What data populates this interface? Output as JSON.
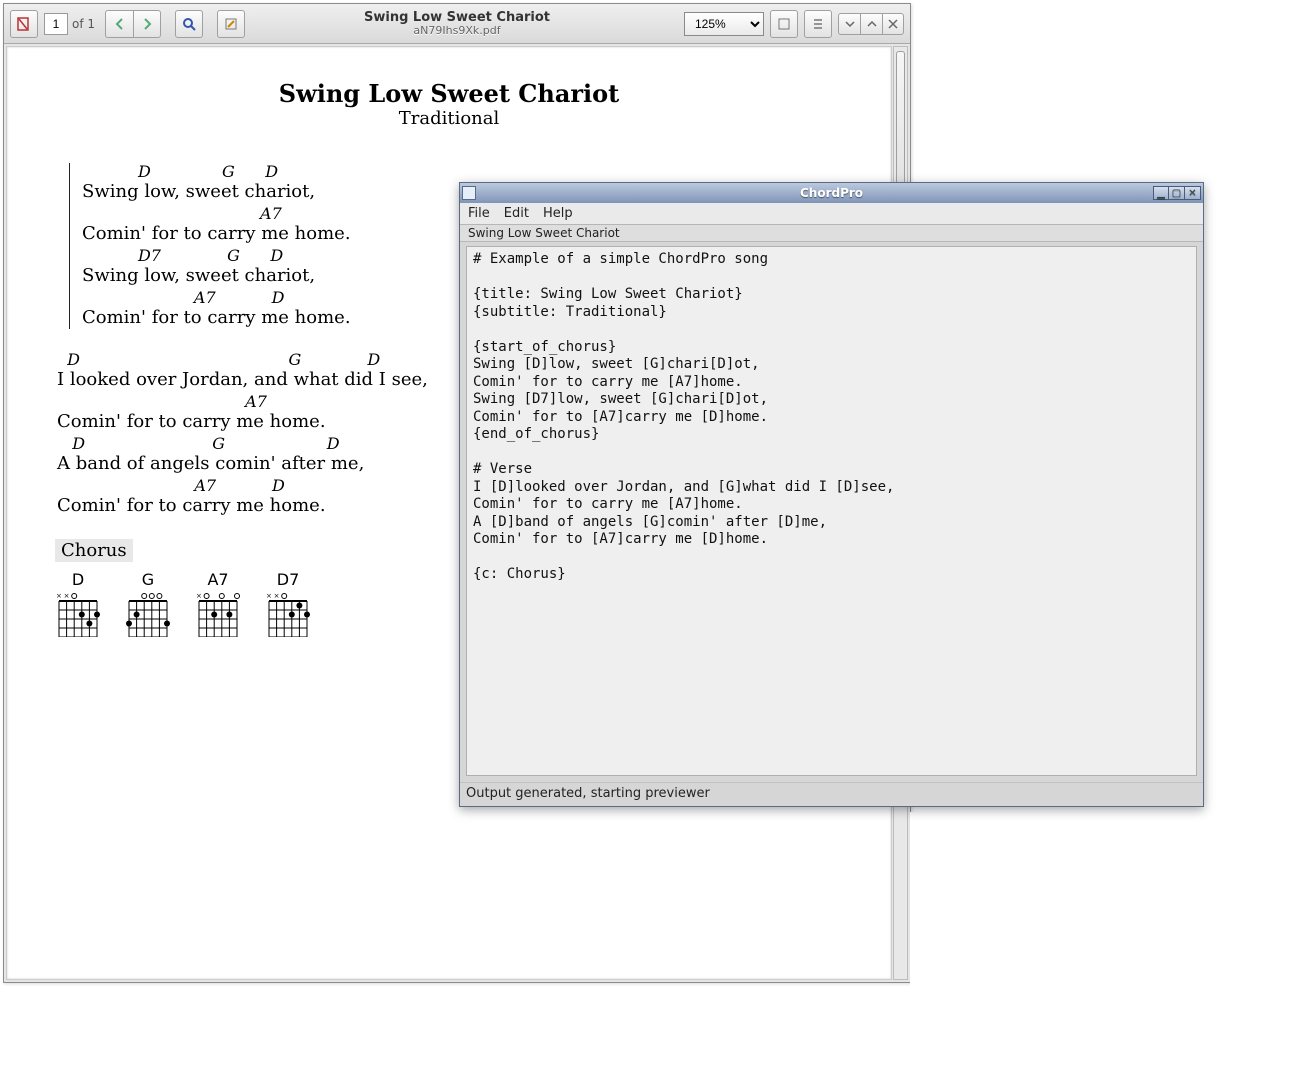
{
  "pdf_viewer": {
    "doc_title": "Swing Low Sweet Chariot",
    "doc_filename": "aN79Ihs9Xk.pdf",
    "page_current": "1",
    "page_of": "of 1",
    "zoom": "125%"
  },
  "song": {
    "title": "Swing Low Sweet Chariot",
    "subtitle": "Traditional",
    "chorus": [
      {
        "chords": "           D              G      D",
        "lyric": "Swing low, sweet chariot,"
      },
      {
        "chords": "                                   A7",
        "lyric": "Comin' for to carry me home."
      },
      {
        "chords": "           D7             G      D",
        "lyric": "Swing low, sweet chariot,"
      },
      {
        "chords": "                      A7           D",
        "lyric": "Comin' for to carry me home."
      }
    ],
    "verse": [
      {
        "chords": "  D                                         G             D",
        "lyric": "I looked over Jordan, and what did I see,"
      },
      {
        "chords": "                                     A7",
        "lyric": "Comin' for to carry me home."
      },
      {
        "chords": "   D                         G                    D",
        "lyric": "A band of angels comin' after me,"
      },
      {
        "chords": "                           A7           D",
        "lyric": "Comin' for to carry me home."
      }
    ],
    "chorus_tag": "Chorus",
    "diagrams": [
      "D",
      "G",
      "A7",
      "D7"
    ]
  },
  "editor": {
    "app_title": "ChordPro",
    "menu": {
      "file": "File",
      "edit": "Edit",
      "help": "Help"
    },
    "tab": "Swing Low Sweet Chariot",
    "text": "# Example of a simple ChordPro song\n\n{title: Swing Low Sweet Chariot}\n{subtitle: Traditional}\n\n{start_of_chorus}\nSwing [D]low, sweet [G]chari[D]ot,\nComin' for to carry me [A7]home.\nSwing [D7]low, sweet [G]chari[D]ot,\nComin' for to [A7]carry me [D]home.\n{end_of_chorus}\n\n# Verse\nI [D]looked over Jordan, and [G]what did I [D]see,\nComin' for to carry me [A7]home.\nA [D]band of angels [G]comin' after [D]me,\nComin' for to [A7]carry me [D]home.\n\n{c: Chorus}",
    "status": "Output generated, starting previewer"
  }
}
